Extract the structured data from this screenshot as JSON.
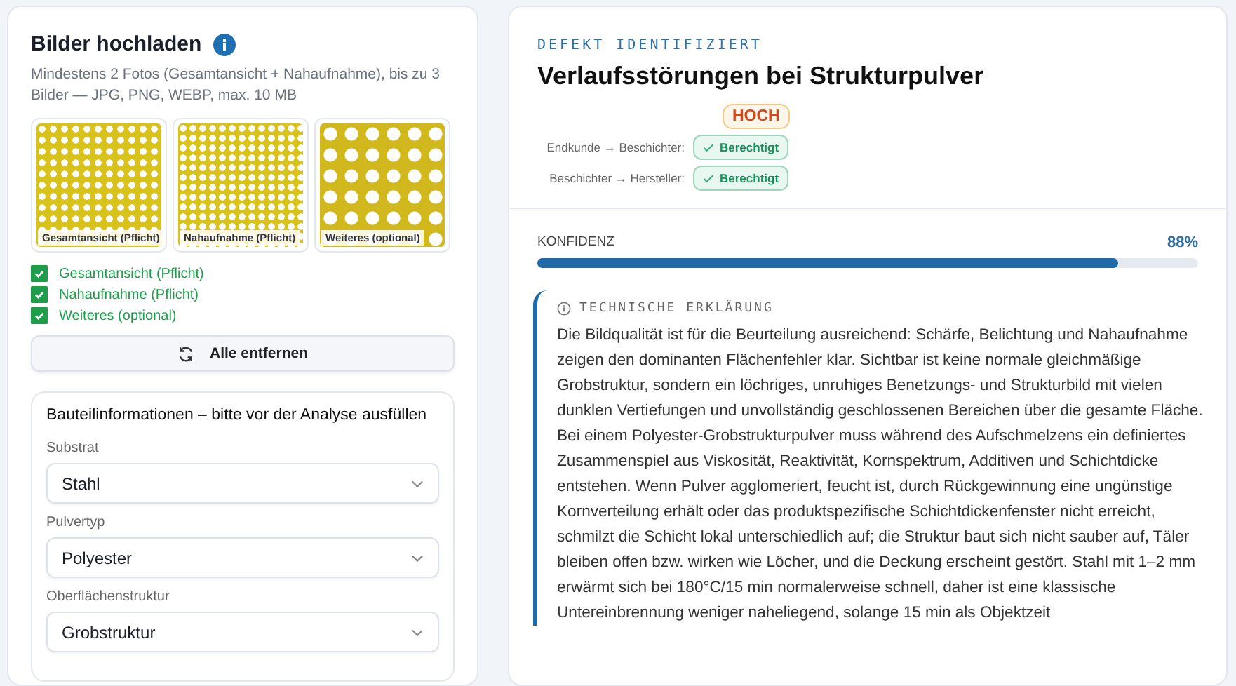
{
  "upload": {
    "title": "Bilder hochladen",
    "description": "Mindestens 2 Fotos (Gesamtansicht + Nahaufnahme), bis zu 3 Bilder — JPG, PNG, WEBP, max. 10 MB",
    "images": [
      {
        "caption": "Gesamtansicht (Pflicht)"
      },
      {
        "caption": "Nahaufnahme (Pflicht)"
      },
      {
        "caption": "Weiteres (optional)"
      }
    ],
    "checklist": [
      {
        "label": "Gesamtansicht (Pflicht)",
        "checked": true
      },
      {
        "label": "Nahaufnahme (Pflicht)",
        "checked": true
      },
      {
        "label": "Weiteres (optional)",
        "checked": true
      }
    ],
    "remove_button": "Alle entfernen"
  },
  "part_info": {
    "title": "Bauteilinformationen – bitte vor der Analyse ausfüllen",
    "fields": [
      {
        "label": "Substrat",
        "value": "Stahl"
      },
      {
        "label": "Pulvertyp",
        "value": "Polyester"
      },
      {
        "label": "Oberflächenstruktur",
        "value": "Grobstruktur"
      }
    ]
  },
  "result": {
    "eyebrow": "DEFEKT IDENTIFIZIERT",
    "title": "Verlaufsstörungen bei Strukturpulver",
    "severity": "HOCH",
    "claims": [
      {
        "label": "Endkunde → Beschichter:",
        "status": "Berechtigt"
      },
      {
        "label": "Beschichter → Hersteller:",
        "status": "Berechtigt"
      }
    ],
    "confidence": {
      "label": "KONFIDENZ",
      "reading": "88%",
      "level": 0.88
    },
    "explanation": {
      "title": "TECHNISCHE ERKLÄRUNG",
      "text": "Die Bildqualität ist für die Beurteilung ausreichend: Schärfe, Belichtung und Nahaufnahme zeigen den dominanten Flächenfehler klar. Sichtbar ist keine normale gleichmäßige Grobstruktur, sondern ein löchriges, unruhiges Benetzungs- und Strukturbild mit vielen dunklen Vertiefungen und unvollständig geschlossenen Bereichen über die gesamte Fläche. Bei einem Polyester-Grobstrukturpulver muss während des Aufschmelzens ein definiertes Zusammenspiel aus Viskosität, Reaktivität, Kornspektrum, Additiven und Schichtdicke entstehen. Wenn Pulver agglomeriert, feucht ist, durch Rückgewinnung eine ungünstige Kornverteilung erhält oder das produktspezifische Schichtdickenfenster nicht erreicht, schmilzt die Schicht lokal unterschiedlich auf; die Struktur baut sich nicht sauber auf, Täler bleiben offen bzw. wirken wie Löcher, und die Deckung erscheint gestört. Stahl mit 1–2 mm erwärmt sich bei 180°C/15 min normalerweise schnell, daher ist eine klassische Untereinbrennung weniger naheliegend, solange 15 min als Objektzeit"
    }
  }
}
